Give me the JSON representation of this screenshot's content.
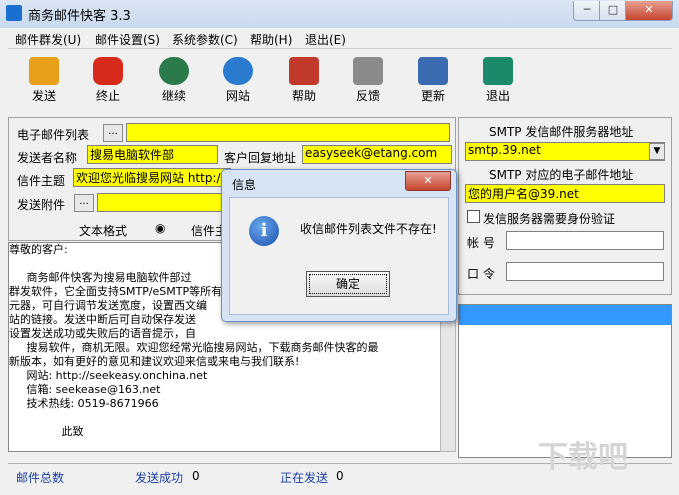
{
  "window": {
    "title": "商务邮件快客 3.3",
    "min": "─",
    "max": "□",
    "close": "✕"
  },
  "menu": [
    "邮件群发(U)",
    "邮件设置(S)",
    "系统参数(C)",
    "帮助(H)",
    "退出(E)"
  ],
  "toolbar": [
    {
      "label": "发送",
      "icon": "send-icon",
      "color": "#e8a01a"
    },
    {
      "label": "终止",
      "icon": "stop-icon",
      "color": "#d82a1a"
    },
    {
      "label": "继续",
      "icon": "continue-icon",
      "color": "#2a7a4a"
    },
    {
      "label": "网站",
      "icon": "globe-icon",
      "color": "#2a7ad0"
    },
    {
      "label": "帮助",
      "icon": "help-icon",
      "color": "#c0392b"
    },
    {
      "label": "反馈",
      "icon": "feedback-icon",
      "color": "#8a8a8a"
    },
    {
      "label": "更新",
      "icon": "update-icon",
      "color": "#3a6ab0"
    },
    {
      "label": "退出",
      "icon": "exit-icon",
      "color": "#1a8a6a"
    }
  ],
  "form": {
    "list_label": "电子邮件列表",
    "list_browse": "...",
    "sender_label": "发送者名称",
    "sender_value": "搜易电脑软件部",
    "reply_label": "客户回复地址",
    "reply_value": "easyseek@etang.com",
    "subject_label": "信件主题",
    "subject_value": "欢迎您光临搜易网站 http:/",
    "attach_label": "发送附件",
    "attach_browse": "...",
    "format_label": "文本格式",
    "letter_label": "信件主"
  },
  "body_text": "尊敬的客户:\n\n     商务邮件快客为搜易电脑软件部过\n群发软件，它全面支持SMTP/eSMTP等所有\n元器，可自行调节发送宽度，设置西文编\n站的链接。发送中断后可自动保存发送\n设置发送成功或失败后的语音提示，自\n     搜易软件，商机无限。欢迎您经常光临搜易网站，下载商务邮件快客的最\n新版本，如有更好的意见和建议欢迎来信或来电与我们联系!\n     网站: http://seekeasy.onchina.net\n     信箱: seekease@163.net\n     技术热线: 0519-8671966\n\n               此致\n\n          敬礼!",
  "smtp": {
    "server_title": "SMTP 发信邮件服务器地址",
    "server_value": "smtp.39.net",
    "account_title": "SMTP 对应的电子邮件地址",
    "account_value": "您的用户名@39.net",
    "auth_label": "发信服务器需要身份验证",
    "user_label": "帐  号",
    "pass_label": "口  令"
  },
  "dialog": {
    "title": "信息",
    "message": "收信邮件列表文件不存在!",
    "ok": "确定",
    "close": "✕"
  },
  "status": {
    "total_label": "邮件总数",
    "success_label": "发送成功",
    "success_value": "0",
    "sending_label": "正在发送",
    "sending_value": "0"
  },
  "watermark": "下载吧"
}
